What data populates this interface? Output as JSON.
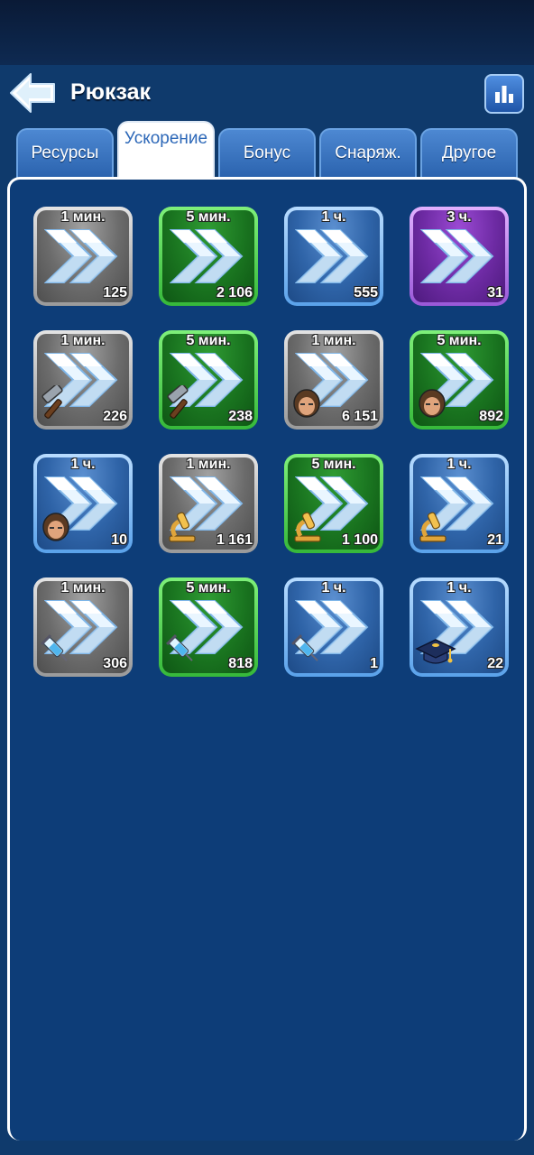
{
  "header": {
    "title": "Рюкзак"
  },
  "tabs": [
    {
      "label": "Ресурсы",
      "active": false
    },
    {
      "label": "Ускорение",
      "active": true
    },
    {
      "label": "Бонус",
      "active": false
    },
    {
      "label": "Снаряж.",
      "active": false
    },
    {
      "label": "Другое",
      "active": false
    }
  ],
  "items": [
    {
      "duration": "1 мин.",
      "count": "125",
      "rarity": "gray",
      "type": "general"
    },
    {
      "duration": "5 мин.",
      "count": "2 106",
      "rarity": "green",
      "type": "general"
    },
    {
      "duration": "1 ч.",
      "count": "555",
      "rarity": "blue",
      "type": "general"
    },
    {
      "duration": "3 ч.",
      "count": "31",
      "rarity": "purple",
      "type": "general"
    },
    {
      "duration": "1 мин.",
      "count": "226",
      "rarity": "gray",
      "type": "hammer-icon"
    },
    {
      "duration": "5 мин.",
      "count": "238",
      "rarity": "green",
      "type": "hammer-icon"
    },
    {
      "duration": "1 мин.",
      "count": "6 151",
      "rarity": "gray",
      "type": "soldier-icon"
    },
    {
      "duration": "5 мин.",
      "count": "892",
      "rarity": "green",
      "type": "soldier-icon"
    },
    {
      "duration": "1 ч.",
      "count": "10",
      "rarity": "blue",
      "type": "soldier-icon"
    },
    {
      "duration": "1 мин.",
      "count": "1 161",
      "rarity": "gray",
      "type": "microscope-icon"
    },
    {
      "duration": "5 мин.",
      "count": "1 100",
      "rarity": "green",
      "type": "microscope-icon"
    },
    {
      "duration": "1 ч.",
      "count": "21",
      "rarity": "blue",
      "type": "microscope-icon"
    },
    {
      "duration": "1 мин.",
      "count": "306",
      "rarity": "gray",
      "type": "syringe-icon"
    },
    {
      "duration": "5 мин.",
      "count": "818",
      "rarity": "green",
      "type": "syringe-icon"
    },
    {
      "duration": "1 ч.",
      "count": "1",
      "rarity": "blue",
      "type": "syringe-icon"
    },
    {
      "duration": "1 ч.",
      "count": "22",
      "rarity": "blue",
      "type": "graduation-cap-icon"
    }
  ]
}
